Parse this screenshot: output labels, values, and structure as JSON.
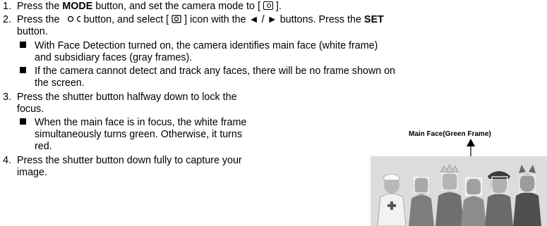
{
  "steps": [
    {
      "num": "1.",
      "text_before": "Press the ",
      "bold": "MODE",
      "text_after": " button, and set the camera mode to [ ",
      "text_end": " ].",
      "icon": "camera-mode-icon"
    },
    {
      "num": "2.",
      "text_before": "Press the ",
      "icon_a": "face-detection-button-icon",
      "text_mid": " button, and select [ ",
      "icon_b": "face-detection-icon",
      "text_after": " ] icon with the ◄ / ► buttons. Press the ",
      "bold": "SET",
      "cont": "button.",
      "bullets": [
        {
          "line1": "With Face Detection turned on, the camera identifies main face (white frame)",
          "line2": "and subsidiary faces (gray frames)."
        },
        {
          "line1": "If the camera cannot detect and track any faces, there will be no frame shown on",
          "line2": "the screen."
        }
      ]
    },
    {
      "num": "3.",
      "line1": "Press the shutter button halfway down to lock the",
      "line2": "focus.",
      "bullets": [
        {
          "line1": "When the main face is in focus, the white frame",
          "line2": "simultaneously turns green. Otherwise, it turns",
          "line3": "red."
        }
      ]
    },
    {
      "num": "4.",
      "line1": "Press the shutter button down fully to capture your",
      "line2": "image."
    }
  ],
  "figure": {
    "caption": "Main Face(Green Frame)"
  },
  "colors": {
    "text": "#000000",
    "photo_bg": "#d9d9d9"
  }
}
